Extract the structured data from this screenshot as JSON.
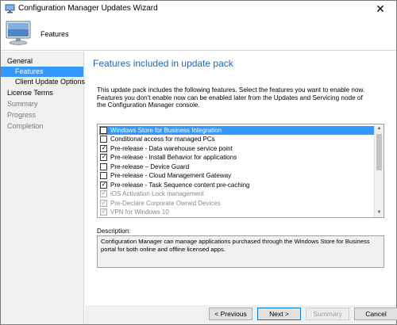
{
  "window": {
    "title": "Configuration Manager Updates Wizard",
    "close_glyph": "✕"
  },
  "header": {
    "title": "Features"
  },
  "nav": {
    "items": [
      {
        "label": "General",
        "state": "normal"
      },
      {
        "label": "Features",
        "state": "selected"
      },
      {
        "label": "Client Update Options",
        "state": "normal"
      },
      {
        "label": "License Terms",
        "state": "normal"
      },
      {
        "label": "Summary",
        "state": "disabled"
      },
      {
        "label": "Progress",
        "state": "disabled"
      },
      {
        "label": "Completion",
        "state": "disabled"
      }
    ]
  },
  "main": {
    "title": "Features included in update pack",
    "intro_line1": "This update pack includes the following features. Select the features you want to enable now.",
    "intro_line2": "Features you don't enable now can be enabled later from the Updates and Servicing node of the Configuration Manager console.",
    "features": [
      {
        "label": "Windows Store for Business Integration",
        "checked": false,
        "enabled": true,
        "selected": true
      },
      {
        "label": "Conditional access for managed PCs",
        "checked": false,
        "enabled": true,
        "selected": false
      },
      {
        "label": "Pre-release - Data warehouse service point",
        "checked": true,
        "enabled": true,
        "selected": false
      },
      {
        "label": "Pre-release - Install Behavior for applications",
        "checked": true,
        "enabled": true,
        "selected": false
      },
      {
        "label": "Pre-release – Device Guard",
        "checked": false,
        "enabled": true,
        "selected": false
      },
      {
        "label": "Pre-release - Cloud Management Gateway",
        "checked": false,
        "enabled": true,
        "selected": false
      },
      {
        "label": "Pre-release - Task Sequence content pre-caching",
        "checked": true,
        "enabled": true,
        "selected": false
      },
      {
        "label": "iOS Activation Lock management",
        "checked": true,
        "enabled": false,
        "selected": false
      },
      {
        "label": "Pre-Declare Corporate Owned Devices",
        "checked": true,
        "enabled": false,
        "selected": false
      },
      {
        "label": "VPN for Windows 10",
        "checked": true,
        "enabled": false,
        "selected": false
      }
    ],
    "check_glyph": "✓",
    "scroll_up_glyph": "▲",
    "scroll_down_glyph": "▼",
    "description_label": "Description:",
    "description_text": "Configuration Manager can manage applications purchased through the Windows Store for Business portal for both online and offline licensed apps."
  },
  "footer": {
    "previous_label": "< Previous",
    "next_label": "Next >",
    "summary_label": "Summary",
    "cancel_label": "Cancel"
  },
  "colors": {
    "selection": "#3399ff",
    "title_blue": "#1e66b4",
    "panel_gray": "#f0f0f0"
  },
  "icons": {
    "title": "computer-icon",
    "header": "computer-monitor-icon"
  }
}
